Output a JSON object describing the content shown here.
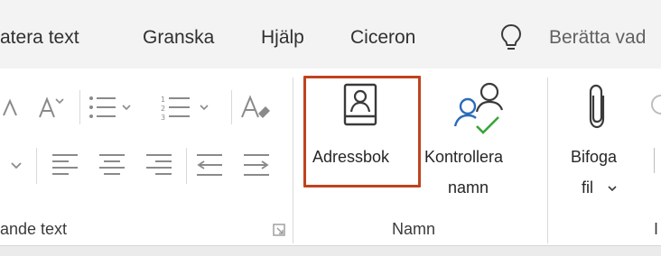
{
  "tabs": [
    {
      "label": "atera text",
      "icon": null
    },
    {
      "label": "Granska",
      "icon": null
    },
    {
      "label": "Hjälp",
      "icon": null
    },
    {
      "label": "Ciceron",
      "icon": null
    },
    {
      "label": "Berätta vad",
      "icon": "lightbulb-icon"
    }
  ],
  "groups": {
    "text_group_label": "ande text",
    "names_group_label": "Namn",
    "cut_group_label": "I"
  },
  "buttons": {
    "address_book": "Adressbok",
    "check_names_line1": "Kontrollera",
    "check_names_line2": "namn",
    "attach_file_line1": "Bifoga",
    "attach_file_line2": "fil",
    "attach_file_dropdown": "chevron-down-icon"
  },
  "colors": {
    "highlight": "#c0431d",
    "check_green": "#3aa53a",
    "person_blue": "#2b6cb8"
  }
}
